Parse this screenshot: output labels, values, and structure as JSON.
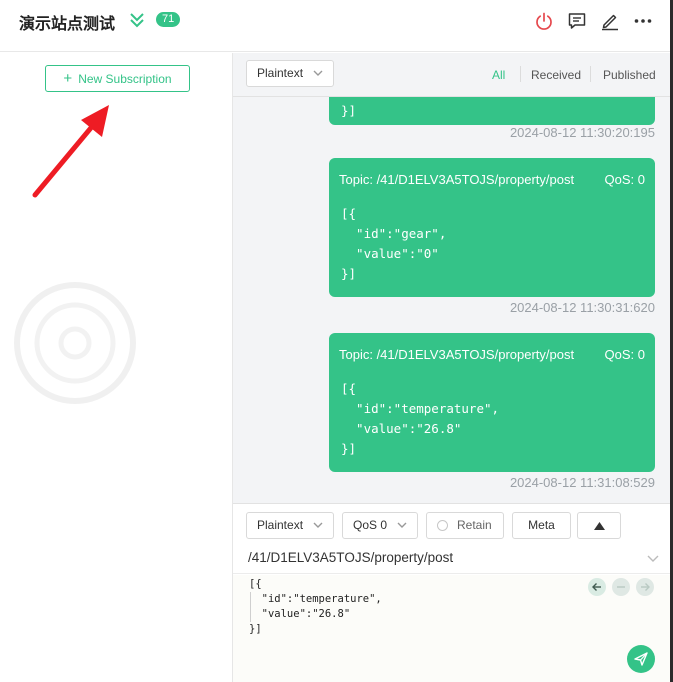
{
  "header": {
    "connection_name": "演示站点测试",
    "message_count": "71",
    "icons": [
      "double-chevron-down-icon",
      "power-icon",
      "comment-icon",
      "edit-icon",
      "more-icon"
    ],
    "colors": {
      "accent": "#34c388",
      "power": "#e5484d"
    }
  },
  "subscriptions": {
    "new_button_label": "New Subscription",
    "new_button_icon": "plus-icon"
  },
  "message_toolbar": {
    "payload_type": "Plaintext",
    "filters": {
      "all": "All",
      "received": "Received",
      "published": "Published"
    },
    "active_filter": "All"
  },
  "messages": [
    {
      "closing": "}]",
      "time": "2024-08-12 11:30:20:195"
    },
    {
      "topic_label": "Topic: /41/D1ELV3A5TOJS/property/post",
      "qos_label": "QoS: 0",
      "payload_lines": [
        "[{",
        "  \"id\":\"gear\",",
        "  \"value\":\"0\"",
        "}]"
      ],
      "time": "2024-08-12 11:30:31:620"
    },
    {
      "topic_label": "Topic: /41/D1ELV3A5TOJS/property/post",
      "qos_label": "QoS: 0",
      "payload_lines": [
        "[{",
        "  \"id\":\"temperature\",",
        "  \"value\":\"26.8\"",
        "}]"
      ],
      "time": "2024-08-12 11:31:08:529"
    }
  ],
  "publish": {
    "payload_type": "Plaintext",
    "qos": "QoS 0",
    "retain_label": "Retain",
    "meta_label": "Meta",
    "topic": "/41/D1ELV3A5TOJS/property/post",
    "payload_lines": [
      "[{",
      "  \"id\":\"temperature\",",
      "  \"value\":\"26.8\"",
      "}]"
    ]
  }
}
